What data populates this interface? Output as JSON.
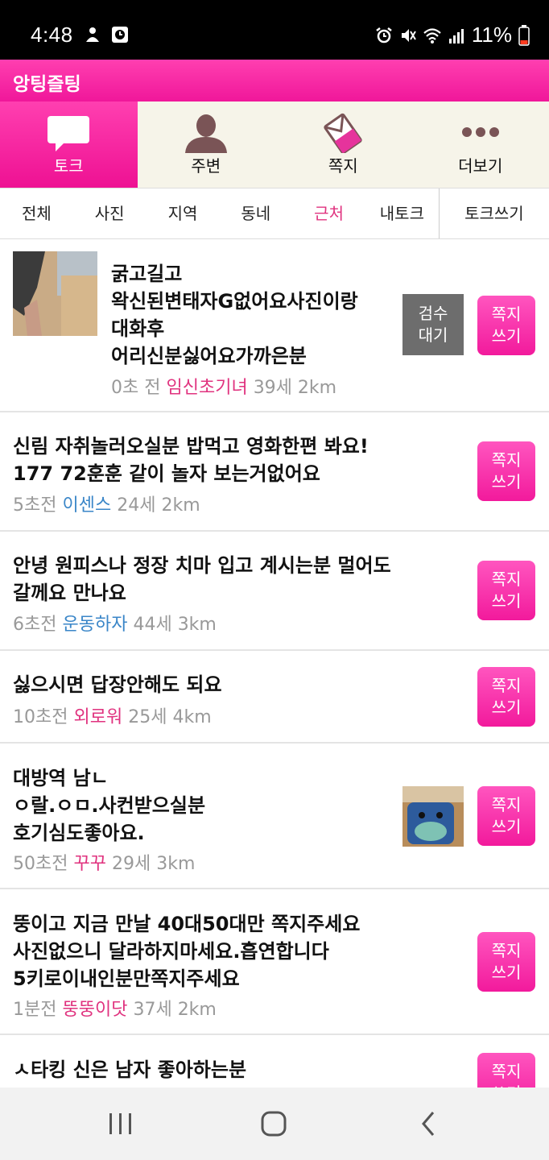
{
  "status_bar": {
    "time": "4:48",
    "battery": "11%",
    "icons_left": [
      "person-icon",
      "clock-box-icon"
    ],
    "icons_right": [
      "alarm-icon",
      "mute-icon",
      "wifi-icon",
      "signal-icon",
      "battery-icon"
    ]
  },
  "app": {
    "title": "앙팅즐팅",
    "brand_color": "#f0179a"
  },
  "main_tabs": [
    {
      "label": "토크",
      "icon": "chat-bubble-icon",
      "active": true
    },
    {
      "label": "주변",
      "icon": "person-silhouette-icon",
      "active": false
    },
    {
      "label": "쪽지",
      "icon": "note-icon",
      "active": false
    },
    {
      "label": "더보기",
      "icon": "more-dots-icon",
      "active": false
    }
  ],
  "sub_tabs": [
    {
      "label": "전체",
      "active": false
    },
    {
      "label": "사진",
      "active": false
    },
    {
      "label": "지역",
      "active": false
    },
    {
      "label": "동네",
      "active": false
    },
    {
      "label": "근처",
      "active": true
    },
    {
      "label": "내토크",
      "active": false
    }
  ],
  "write_talk_label": "토크쓰기",
  "message_button": {
    "line1": "쪽지",
    "line2": "쓰기"
  },
  "review_button": {
    "line1": "검수",
    "line2": "대기"
  },
  "posts": [
    {
      "lines": [
        "굵고길고",
        "왁신된변태자G없어요사진이랑",
        "대화후",
        "어리신분싫어요가까은분"
      ],
      "time": "0초 전",
      "nickname": "임신초기녀",
      "nickname_color": "pink",
      "age": "39세",
      "distance": "2km",
      "has_thumb_left": true,
      "status": "검수대기"
    },
    {
      "lines": [
        "신림 자취놀러오실분 밥먹고 영화한편 봐요!",
        "177 72훈훈 같이 놀자 보는거없어요"
      ],
      "time": "5초전",
      "nickname": "이센스",
      "nickname_color": "blue",
      "age": "24세",
      "distance": "2km"
    },
    {
      "lines": [
        "안녕 원피스나 정장 치마 입고 계시는분 멀어도",
        "갈께요 만나요"
      ],
      "time": "6초전",
      "nickname": "운동하자",
      "nickname_color": "blue",
      "age": "44세",
      "distance": "3km"
    },
    {
      "lines": [
        "싫으시면 답장안해도 되요"
      ],
      "time": "10초전",
      "nickname": "외로워",
      "nickname_color": "pink",
      "age": "25세",
      "distance": "4km"
    },
    {
      "lines": [
        "대방역 남ㄴ",
        "ㅇ랄.ㅇㅁ.사컨받으실분",
        "호기심도좋아요."
      ],
      "time": "50초전",
      "nickname": "꾸꾸",
      "nickname_color": "pink",
      "age": "29세",
      "distance": "3km",
      "has_thumb_right": true
    },
    {
      "lines": [
        "뚱이고 지금 만날 40대50대만 쪽지주세요",
        "사진없으니 달라하지마세요.흡연합니다",
        "5키로이내인분만쪽지주세요"
      ],
      "time": "1분전",
      "nickname": "뚱뚱이닷",
      "nickname_color": "pink",
      "age": "37세",
      "distance": "2km"
    },
    {
      "lines": [
        "ㅅ타킹 신은 남자 좋아하는분"
      ]
    }
  ],
  "nav_bar": {
    "icons": [
      "recent-apps-icon",
      "home-icon",
      "back-icon"
    ]
  }
}
